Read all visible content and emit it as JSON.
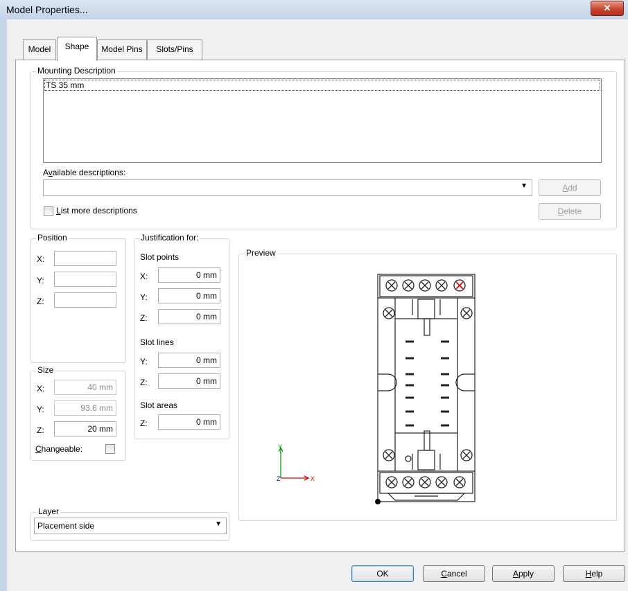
{
  "window": {
    "title": "Model Properties..."
  },
  "tabs": [
    {
      "label": "Model"
    },
    {
      "label": "Shape"
    },
    {
      "label": "Model Pins"
    },
    {
      "label": "Slots/Pins"
    }
  ],
  "mounting": {
    "group_label": "Mounting Description",
    "items": [
      "TS 35 mm"
    ],
    "available_label_pre": "A",
    "available_label_acc": "v",
    "available_label_post": "ailable descriptions:",
    "available_value": "",
    "add_pre": "",
    "add_acc": "A",
    "add_post": "dd",
    "delete_acc": "D",
    "delete_post": "elete",
    "list_more_acc": "L",
    "list_more_post": "ist more descriptions"
  },
  "position": {
    "group_label": "Position",
    "x_label": "X:",
    "y_label": "Y:",
    "z_label": "Z:",
    "x_value": "",
    "y_value": "",
    "z_value": ""
  },
  "size": {
    "group_label": "Size",
    "x_label": "X:",
    "y_label": "Y:",
    "z_label": "Z:",
    "x_value": "40 mm",
    "y_value": "93.6 mm",
    "z_value": "20 mm",
    "changeable_acc": "C",
    "changeable_post": "hangeable:"
  },
  "justification": {
    "group_label": "Justification for:",
    "slot_points": "Slot points",
    "sp_x_label": "X:",
    "sp_x": "0 mm",
    "sp_y_label": "Y:",
    "sp_y": "0 mm",
    "sp_z_label": "Z:",
    "sp_z": "0 mm",
    "slot_lines": "Slot lines",
    "sl_y_label": "Y:",
    "sl_y": "0 mm",
    "sl_z_label": "Z:",
    "sl_z": "0 mm",
    "slot_areas": "Slot areas",
    "sa_z_label": "Z:",
    "sa_z": "0 mm"
  },
  "preview": {
    "group_label": "Preview",
    "axis_y": "Y",
    "axis_x": "X",
    "axis_z": "Z"
  },
  "layer": {
    "group_label": "Layer",
    "value": "Placement side"
  },
  "buttons": {
    "ok": "OK",
    "cancel_acc": "C",
    "cancel_post": "ancel",
    "apply_acc": "A",
    "apply_post": "pply",
    "help_acc": "H",
    "help_post": "elp"
  },
  "colors": {
    "axis_y": "#00a000",
    "axis_x": "#e00000",
    "axis_z": "#0000d0",
    "marker": "#e00000"
  }
}
